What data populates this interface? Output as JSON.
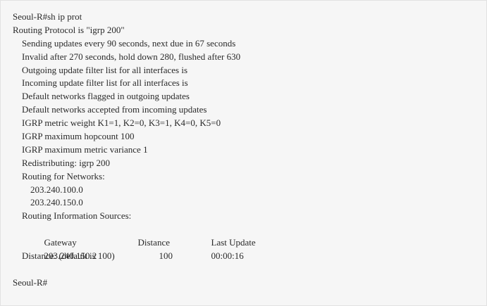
{
  "terminal": {
    "command_line": "Seoul-R#sh ip prot",
    "lines": [
      "Routing Protocol is \"igrp 200\"",
      "Sending updates every 90 seconds, next due in 67 seconds",
      "Invalid after 270 seconds, hold down 280, flushed after 630",
      "Outgoing update filter list for all interfaces is",
      "Incoming update filter list for all interfaces is",
      "Default networks flagged in outgoing updates",
      "Default networks accepted from incoming updates",
      "IGRP metric weight K1=1, K2=0, K3=1, K4=0, K5=0",
      "IGRP maximum hopcount 100",
      "IGRP maximum metric variance 1",
      "Redistributing: igrp 200",
      "Routing for Networks:",
      "203.240.100.0",
      "203.240.150.0",
      "Routing Information Sources:",
      "Distance: (default is 100)"
    ],
    "sources_table": {
      "headers": [
        "Gateway",
        "Distance",
        "Last Update"
      ],
      "rows": [
        [
          "203.240.150.2",
          "100",
          "00:00:16"
        ]
      ]
    },
    "prompt": "Seoul-R#"
  }
}
